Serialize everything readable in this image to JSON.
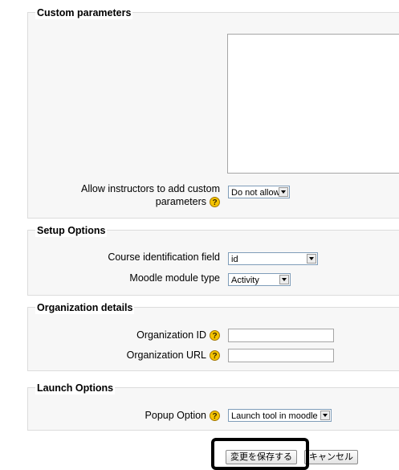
{
  "custom_parameters": {
    "legend": "Custom parameters",
    "allow_label_line1": "Allow instructors to add custom",
    "allow_label_line2": "parameters",
    "allow_value": "Do not allow"
  },
  "setup_options": {
    "legend": "Setup Options",
    "course_field_label": "Course identification field",
    "course_field_value": "id",
    "module_type_label": "Moodle module type",
    "module_type_value": "Activity"
  },
  "organization_details": {
    "legend": "Organization details",
    "org_id_label": "Organization ID",
    "org_url_label": "Organization URL"
  },
  "launch_options": {
    "legend": "Launch Options",
    "popup_label": "Popup Option",
    "popup_value": "Launch tool in moodle"
  },
  "buttons": {
    "save_label": "変更を保存する",
    "cancel_label": "キャンセル"
  },
  "icons": {
    "help": "?"
  },
  "colors": {
    "fieldset_bg": "#f7f7f7",
    "help_icon": "#f5c400"
  }
}
